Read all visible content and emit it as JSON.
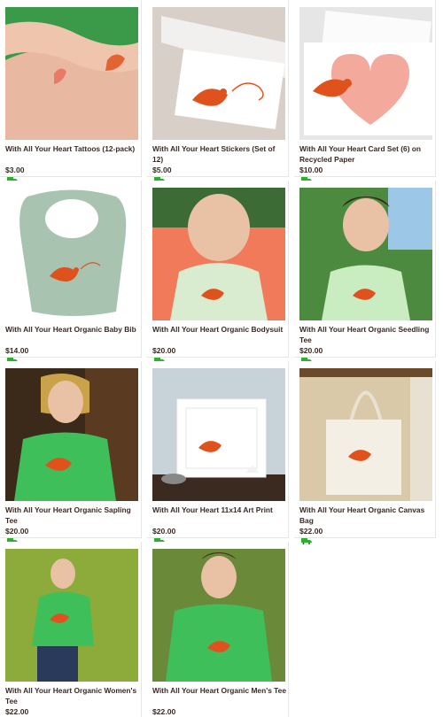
{
  "products": [
    {
      "title": "With All Your Heart Tattoos (12-pack)",
      "price": "$3.00",
      "shipping_icon": "truck-icon"
    },
    {
      "title": "With All Your Heart Stickers (Set of 12)",
      "price": "$5.00",
      "shipping_icon": "truck-icon"
    },
    {
      "title": "With All Your Heart Card Set (6) on Recycled Paper",
      "price": "$10.00",
      "shipping_icon": "truck-icon"
    },
    {
      "title": "With All Your Heart Organic Baby Bib",
      "price": "$14.00",
      "shipping_icon": "truck-icon"
    },
    {
      "title": "With All Your Heart Organic Bodysuit",
      "price": "$20.00",
      "shipping_icon": "truck-icon"
    },
    {
      "title": "With All Your Heart Organic Seedling Tee",
      "price": "$20.00",
      "shipping_icon": "truck-icon"
    },
    {
      "title": "With All Your Heart Organic Sapling Tee",
      "price": "$20.00",
      "shipping_icon": "truck-icon"
    },
    {
      "title": "With All Your Heart 11x14 Art Print",
      "price": "$20.00",
      "shipping_icon": "truck-icon"
    },
    {
      "title": "With All Your Heart Organic Canvas Bag",
      "price": "$22.00",
      "shipping_icon": "truck-icon"
    },
    {
      "title": "With All Your Heart Organic Women's Tee",
      "price": "$22.00",
      "shipping_icon": "truck-icon"
    },
    {
      "title": "With All Your Heart Organic Men's Tee",
      "price": "$22.00",
      "shipping_icon": "truck-icon"
    }
  ],
  "colors": {
    "bird": "#e0521d",
    "heart_pink": "#f3a99b",
    "shirt_green": "#3fbf5a",
    "title_text": "#3a2a25",
    "truck_green": "#2fae2f"
  }
}
